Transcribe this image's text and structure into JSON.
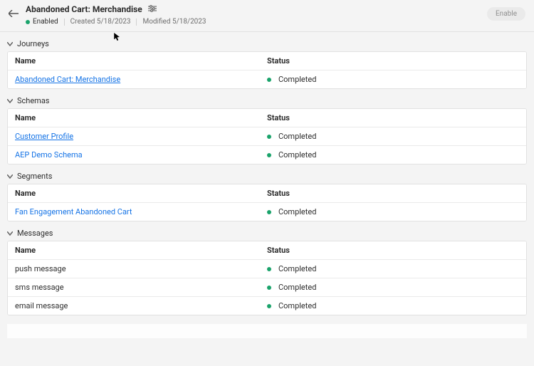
{
  "header": {
    "title": "Abandoned Cart: Merchandise",
    "status_label": "Enabled",
    "created_label": "Created 5/18/2023",
    "modified_label": "Modified 5/18/2023",
    "enable_button": "Enable"
  },
  "columns": {
    "name": "Name",
    "status": "Status"
  },
  "status_text": {
    "completed": "Completed"
  },
  "sections": {
    "journeys": {
      "title": "Journeys",
      "items": [
        {
          "name": "Abandoned Cart: Merchandise",
          "status": "Completed"
        }
      ]
    },
    "schemas": {
      "title": "Schemas",
      "items": [
        {
          "name": "Customer Profile",
          "status": "Completed"
        },
        {
          "name": "AEP Demo Schema",
          "status": "Completed"
        }
      ]
    },
    "segments": {
      "title": "Segments",
      "items": [
        {
          "name": "Fan Engagement Abandoned Cart",
          "status": "Completed"
        }
      ]
    },
    "messages": {
      "title": "Messages",
      "items": [
        {
          "name": "push message",
          "status": "Completed"
        },
        {
          "name": "sms message",
          "status": "Completed"
        },
        {
          "name": "email message",
          "status": "Completed"
        }
      ]
    }
  }
}
